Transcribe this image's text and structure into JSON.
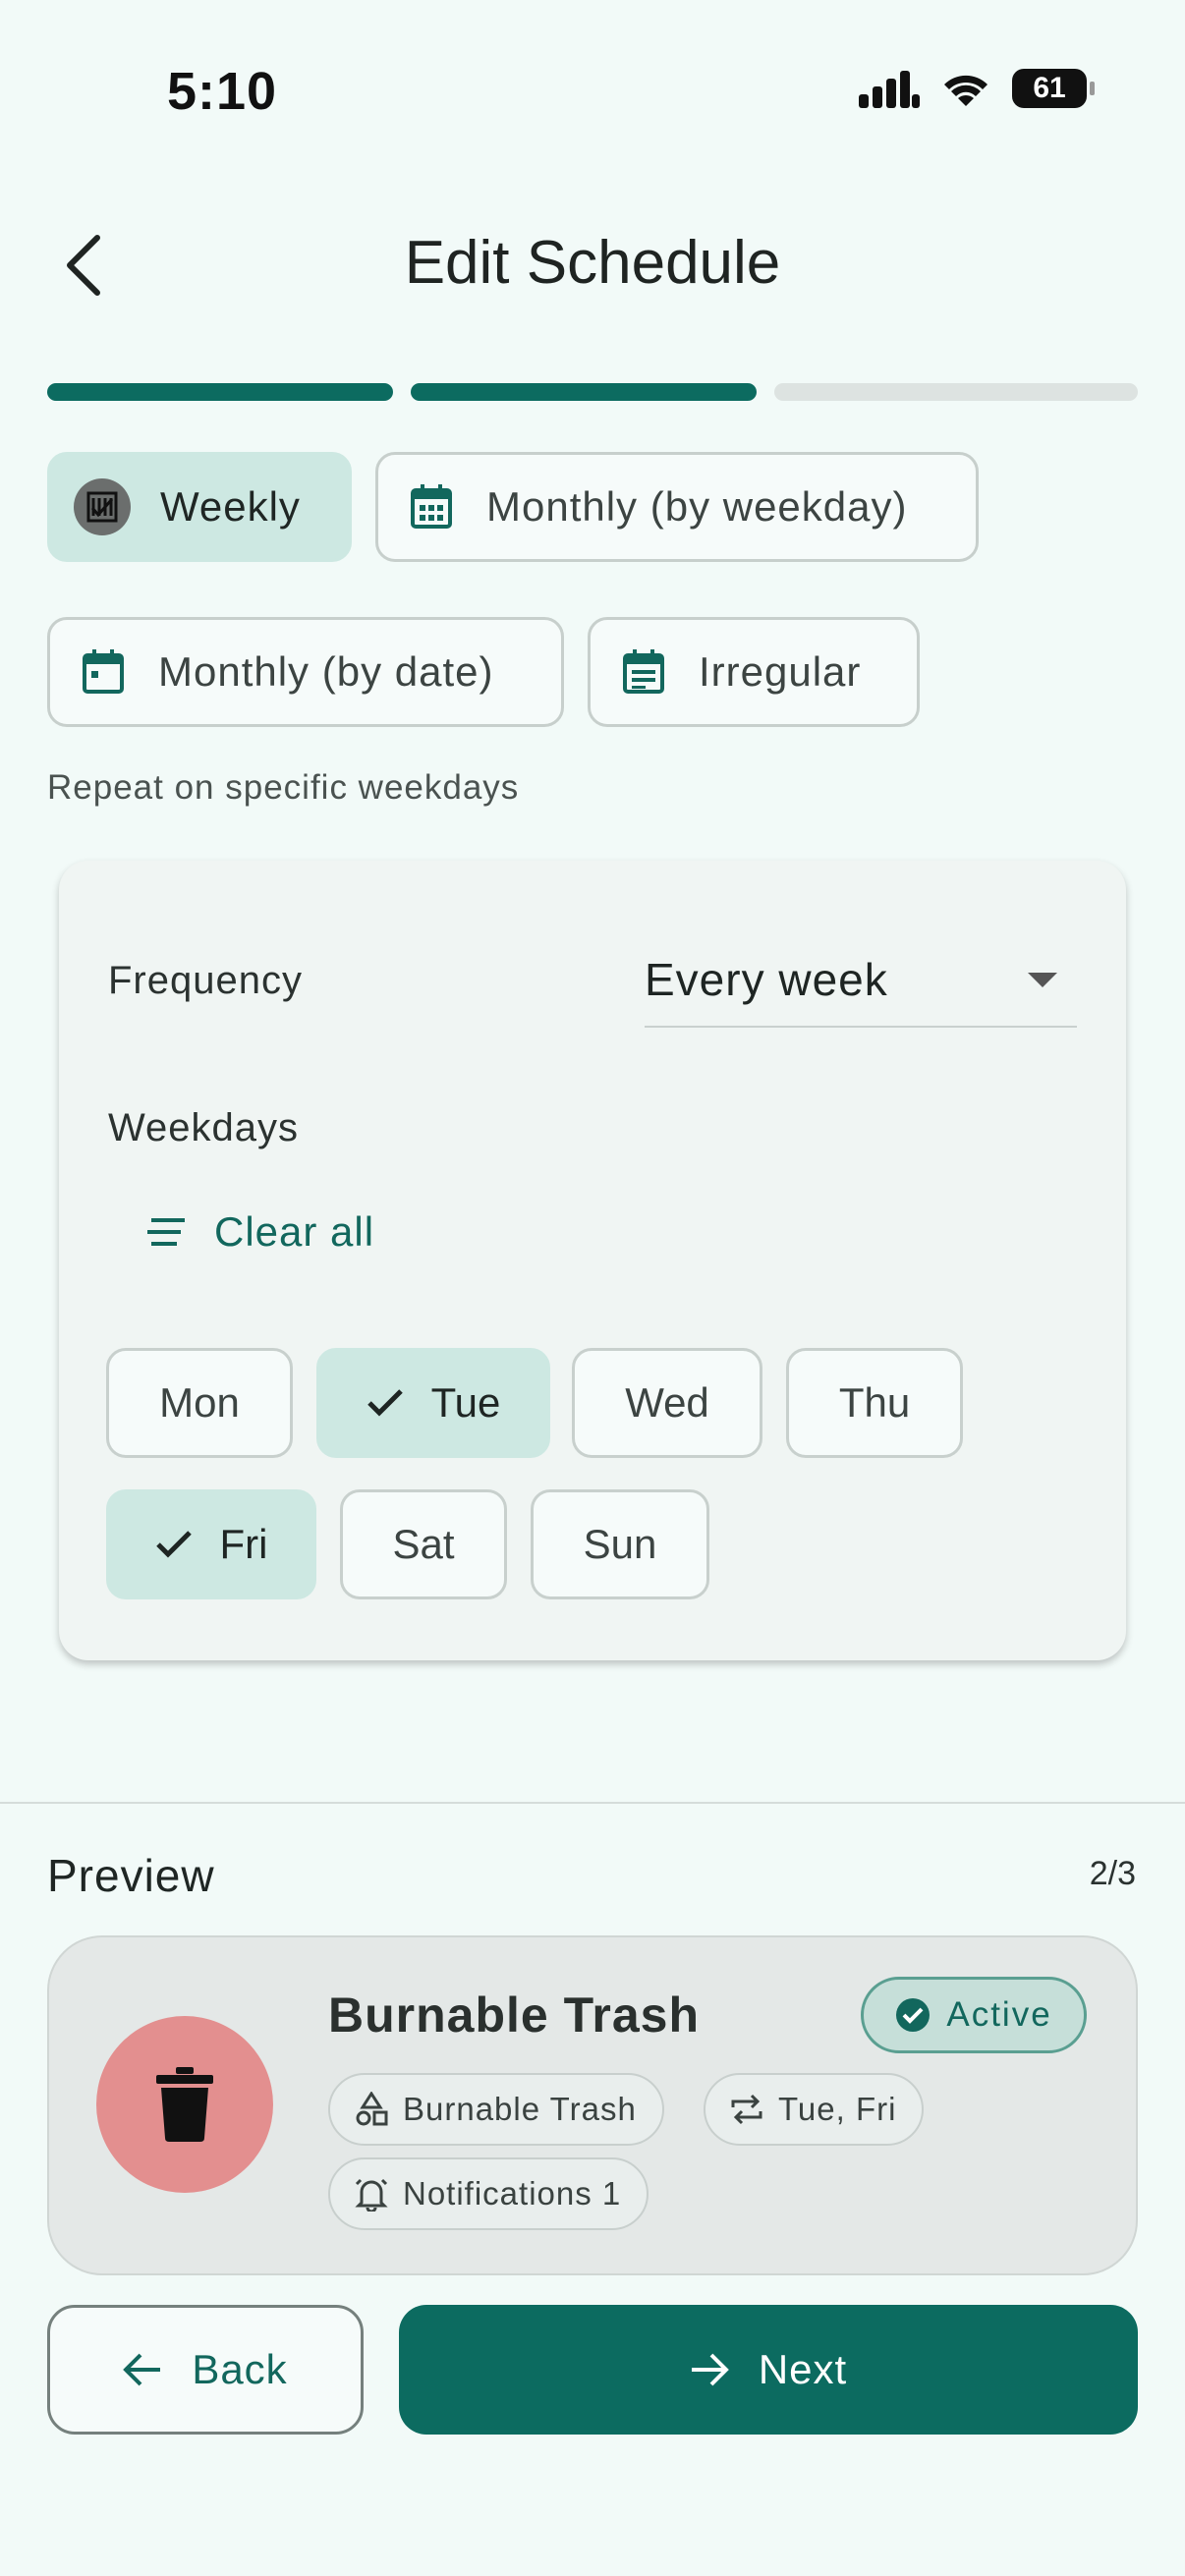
{
  "status_bar": {
    "time": "5:10",
    "battery": "61"
  },
  "header": {
    "title": "Edit Schedule"
  },
  "progress": {
    "current_step": 2,
    "total_steps": 3
  },
  "schedule_types": [
    {
      "label": "Weekly",
      "selected": true,
      "icon": "calendar-week-icon"
    },
    {
      "label": "Monthly (by weekday)",
      "selected": false,
      "icon": "calendar-icon"
    },
    {
      "label": "Monthly (by date)",
      "selected": false,
      "icon": "calendar-icon"
    },
    {
      "label": "Irregular",
      "selected": false,
      "icon": "calendar-list-icon"
    }
  ],
  "description": "Repeat on specific weekdays",
  "card": {
    "frequency_label": "Frequency",
    "frequency_value": "Every week",
    "weekdays_label": "Weekdays",
    "clear_all": "Clear all",
    "days": [
      {
        "label": "Mon",
        "selected": false
      },
      {
        "label": "Tue",
        "selected": true
      },
      {
        "label": "Wed",
        "selected": false
      },
      {
        "label": "Thu",
        "selected": false
      },
      {
        "label": "Fri",
        "selected": true
      },
      {
        "label": "Sat",
        "selected": false
      },
      {
        "label": "Sun",
        "selected": false
      }
    ]
  },
  "preview": {
    "title": "Preview",
    "page": "2/3",
    "name": "Burnable Trash",
    "status": "Active",
    "tags": {
      "category": "Burnable Trash",
      "days": "Tue, Fri",
      "notifications": "Notifications 1"
    }
  },
  "buttons": {
    "back": "Back",
    "next": "Next"
  },
  "colors": {
    "accent": "#0c6b60",
    "selected_chip": "#cde8e2",
    "trash_circle": "#e38f8f",
    "background": "#f2faf8"
  }
}
